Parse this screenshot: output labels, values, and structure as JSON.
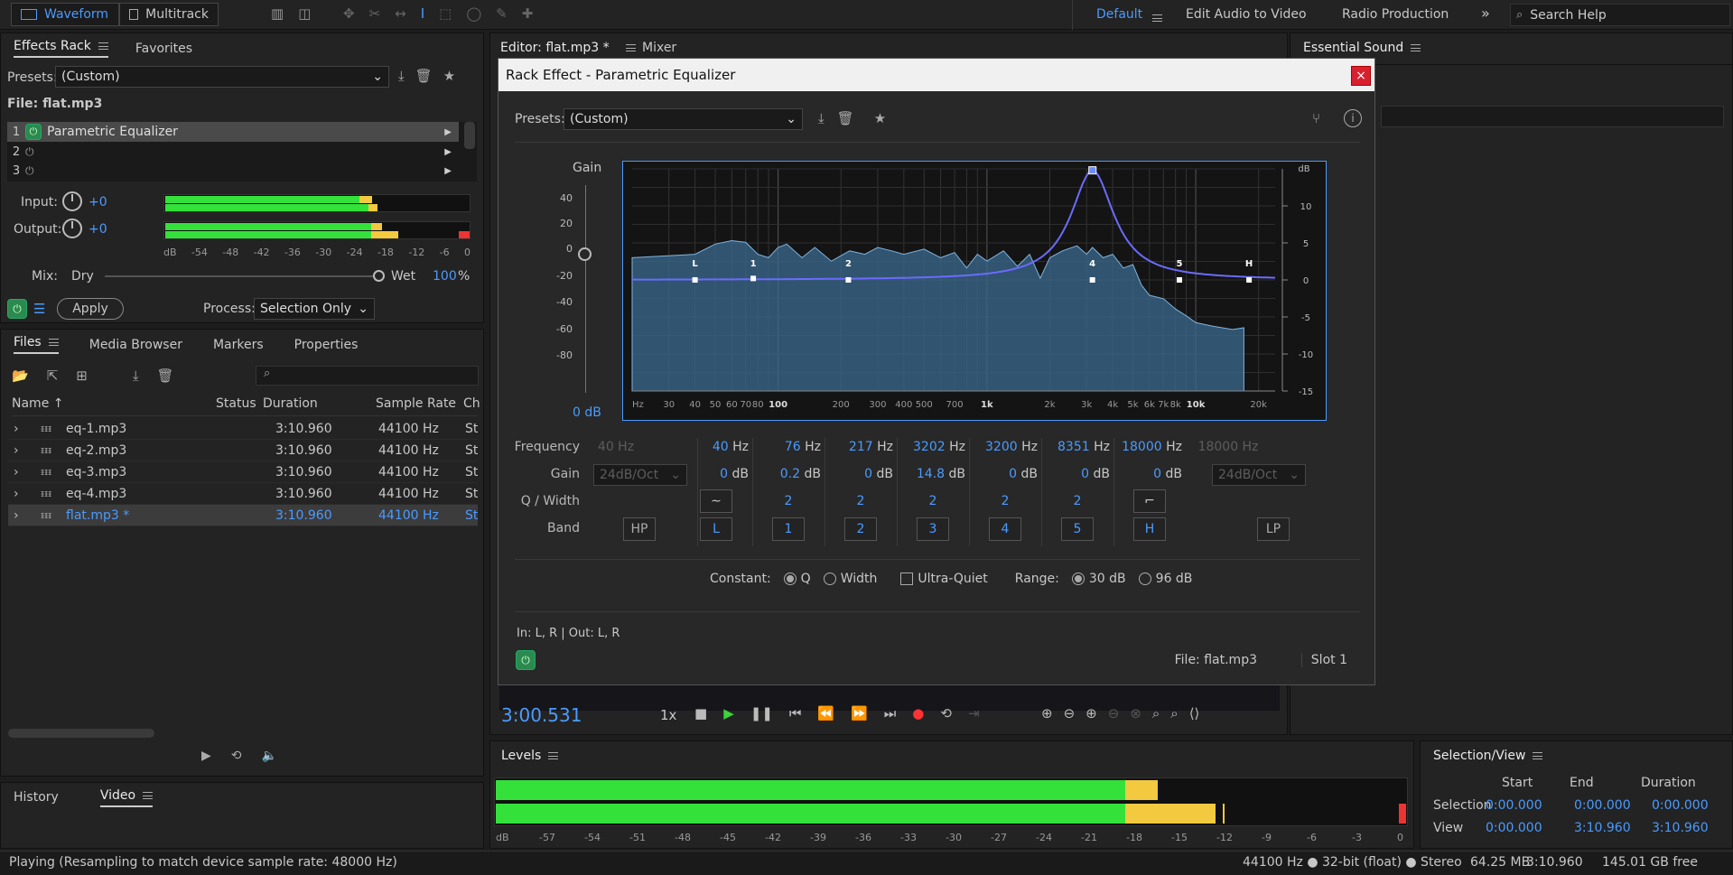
{
  "topbar": {
    "waveform": "Waveform",
    "multitrack": "Multitrack",
    "workspaces": [
      "Default",
      "Edit Audio to Video",
      "Radio Production"
    ],
    "more": "»",
    "search_placeholder": "Search Help"
  },
  "effects_rack": {
    "tab1": "Effects Rack",
    "tab2": "Favorites",
    "presets_label": "Presets:",
    "presets_value": "(Custom)",
    "file_label": "File: flat.mp3",
    "slots": [
      {
        "num": "1",
        "name": "Parametric Equalizer"
      },
      {
        "num": "2",
        "name": ""
      },
      {
        "num": "3",
        "name": ""
      }
    ],
    "input_label": "Input:",
    "input_value": "+0",
    "output_label": "Output:",
    "output_value": "+0",
    "db_scale": [
      "dB",
      "-54",
      "-48",
      "-42",
      "-36",
      "-30",
      "-24",
      "-18",
      "-12",
      "-6",
      "0"
    ],
    "mix_label": "Mix:",
    "dry": "Dry",
    "wet": "Wet",
    "wet_value": "100",
    "percent": "%",
    "apply": "Apply",
    "process_label": "Process:",
    "process_value": "Selection Only"
  },
  "files": {
    "tabs": [
      "Files",
      "Media Browser",
      "Markers",
      "Properties"
    ],
    "columns": [
      "Name",
      "Status",
      "Duration",
      "Sample Rate",
      "Ch"
    ],
    "rows": [
      {
        "name": "eq-1.mp3",
        "status": "",
        "duration": "3:10.960",
        "rate": "44100 Hz",
        "ch": "St"
      },
      {
        "name": "eq-2.mp3",
        "status": "",
        "duration": "3:10.960",
        "rate": "44100 Hz",
        "ch": "St"
      },
      {
        "name": "eq-3.mp3",
        "status": "",
        "duration": "3:10.960",
        "rate": "44100 Hz",
        "ch": "St"
      },
      {
        "name": "eq-4.mp3",
        "status": "",
        "duration": "3:10.960",
        "rate": "44100 Hz",
        "ch": "St"
      },
      {
        "name": "flat.mp3 *",
        "status": "",
        "duration": "3:10.960",
        "rate": "44100 Hz",
        "ch": "St"
      }
    ]
  },
  "history": {
    "tab1": "History",
    "tab2": "Video"
  },
  "editor": {
    "tab": "Editor: flat.mp3 *",
    "mixer": "Mixer",
    "time": "3:00.531",
    "speed": "1x"
  },
  "essential_sound": {
    "title": "Essential Sound"
  },
  "dialog": {
    "title": "Rack Effect - Parametric Equalizer",
    "close": "×",
    "presets_label": "Presets:",
    "presets_value": "(Custom)",
    "gain_label": "Gain",
    "gain_ticks": [
      "40",
      "20",
      "0",
      "-20",
      "-40",
      "-60",
      "-80"
    ],
    "gain_value": "0 dB",
    "db_label": "dB",
    "db_ticks": [
      "10",
      "5",
      "0",
      "-5",
      "-10",
      "-15"
    ],
    "freq_ticks": [
      "Hz",
      "30",
      "40",
      "50",
      "60",
      "70",
      "80",
      "100",
      "200",
      "300",
      "400",
      "500",
      "700",
      "1k",
      "2k",
      "3k",
      "4k",
      "5k",
      "6k",
      "7k",
      "8k",
      "10k",
      "20k"
    ],
    "band_markers": [
      "L",
      "1",
      "2",
      "3",
      "4",
      "5",
      "H"
    ],
    "row_labels": {
      "frequency": "Frequency",
      "gain": "Gain",
      "q": "Q / Width",
      "band": "Band"
    },
    "hp_freq": "40 Hz",
    "hp_slope": "24dB/Oct",
    "lp_freq": "18000 Hz",
    "lp_slope": "24dB/Oct",
    "hz": "Hz",
    "db": "dB",
    "bands": [
      {
        "label": "L",
        "freq": "40",
        "gain": "0",
        "q": ""
      },
      {
        "label": "1",
        "freq": "76",
        "gain": "0.2",
        "q": "2"
      },
      {
        "label": "2",
        "freq": "217",
        "gain": "0",
        "q": "2"
      },
      {
        "label": "3",
        "freq": "3202",
        "gain": "14.8",
        "q": "2"
      },
      {
        "label": "4",
        "freq": "3200",
        "gain": "0",
        "q": "2"
      },
      {
        "label": "5",
        "freq": "8351",
        "gain": "0",
        "q": "2"
      },
      {
        "label": "H",
        "freq": "18000",
        "gain": "0",
        "q": ""
      }
    ],
    "hp_label": "HP",
    "lp_label": "LP",
    "constant_label": "Constant:",
    "q_option": "Q",
    "width_option": "Width",
    "ultra_quiet": "Ultra-Quiet",
    "range_label": "Range:",
    "range_30": "30 dB",
    "range_96": "96 dB",
    "io_info": "In: L, R | Out: L, R",
    "file_info": "File: flat.mp3",
    "slot_info": "Slot 1"
  },
  "levels": {
    "title": "Levels",
    "scale": [
      "dB",
      "-57",
      "-54",
      "-51",
      "-48",
      "-45",
      "-42",
      "-39",
      "-36",
      "-33",
      "-30",
      "-27",
      "-24",
      "-21",
      "-18",
      "-15",
      "-12",
      "-9",
      "-6",
      "-3",
      "0"
    ]
  },
  "selection_view": {
    "title": "Selection/View",
    "headers": [
      "Start",
      "End",
      "Duration"
    ],
    "selection_label": "Selection",
    "selection": [
      "0:00.000",
      "0:00.000",
      "0:00.000"
    ],
    "view_label": "View",
    "view": [
      "0:00.000",
      "3:10.960",
      "3:10.960"
    ]
  },
  "status": {
    "message": "Playing (Resampling to match device sample rate: 48000 Hz)",
    "format": "44100 Hz ● 32-bit (float) ● Stereo",
    "memory": "64.25 MB",
    "duration": "3:10.960",
    "free": "145.01 GB free"
  },
  "colors": {
    "accent": "#4a9bff",
    "meter_green": "#33e13a",
    "meter_yellow": "#f2c93f",
    "eq_curve": "#6b6bff"
  }
}
